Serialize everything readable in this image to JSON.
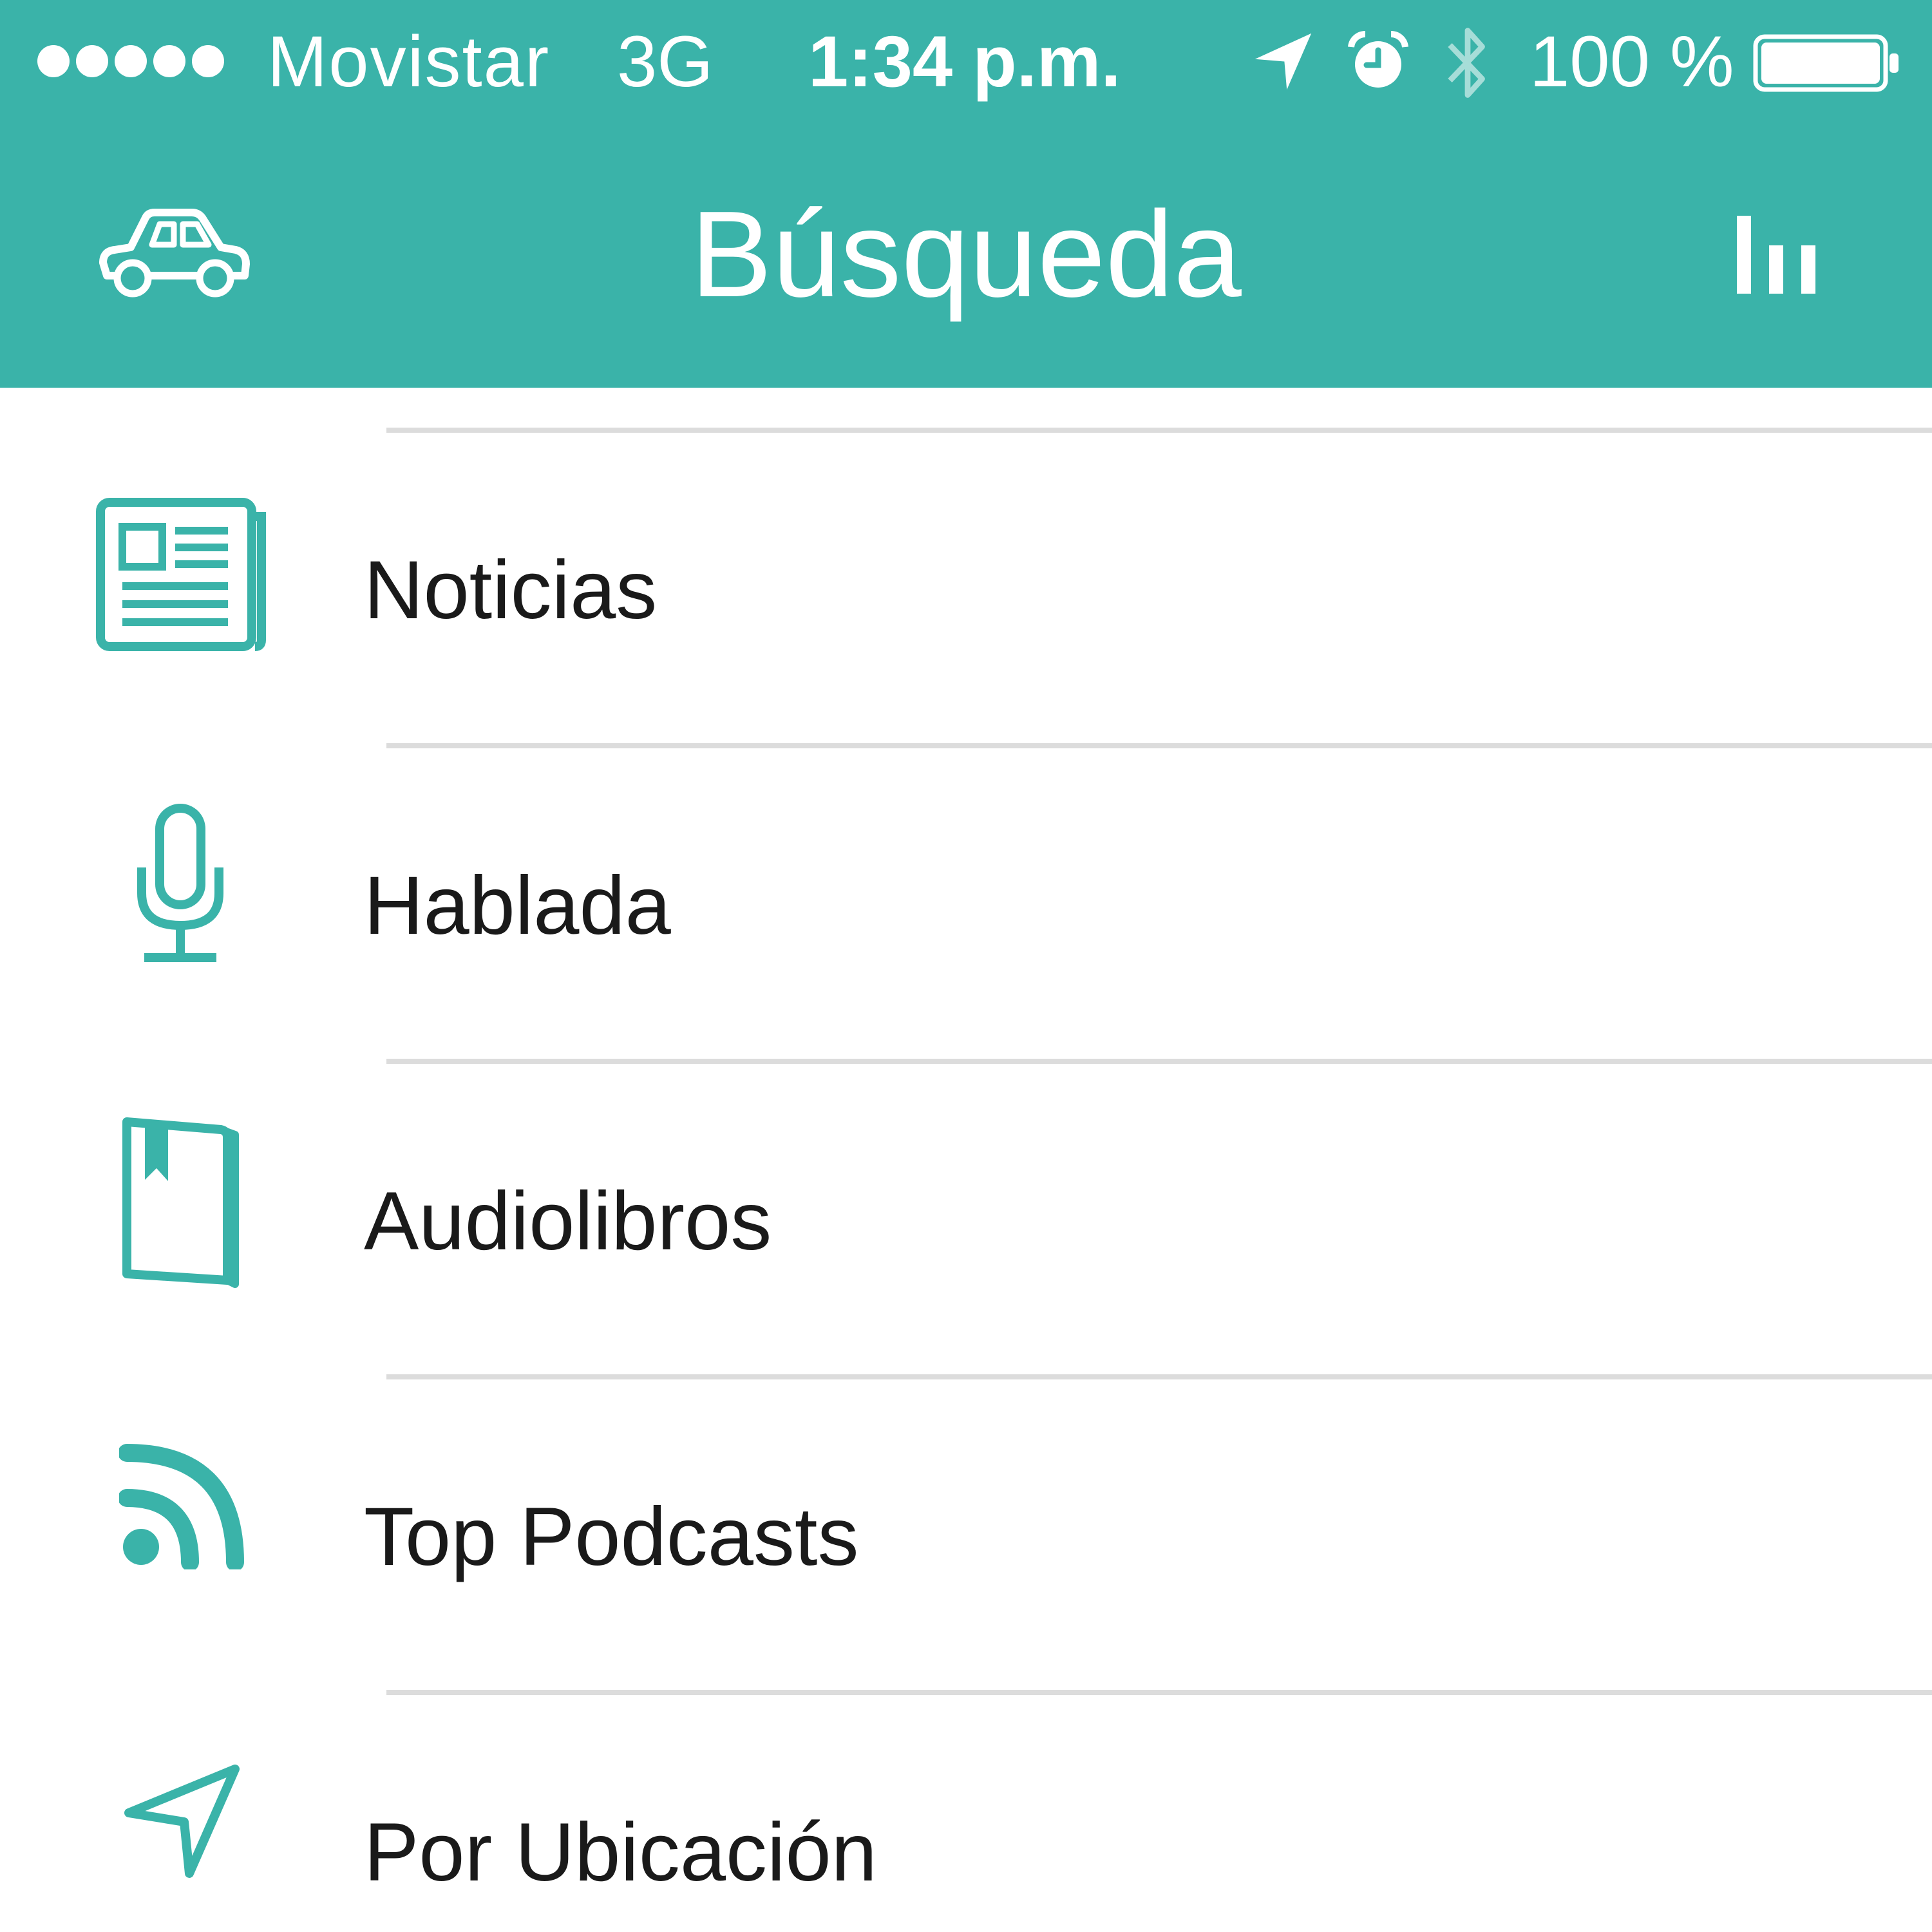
{
  "status_bar": {
    "carrier": "Movistar",
    "network": "3G",
    "time": "1:34 p.m.",
    "battery_percent": "100 %"
  },
  "nav": {
    "title": "Búsqueda"
  },
  "menu": {
    "items": [
      {
        "label": "Noticias",
        "icon": "newspaper-icon"
      },
      {
        "label": "Hablada",
        "icon": "microphone-icon"
      },
      {
        "label": "Audiolibros",
        "icon": "book-icon"
      },
      {
        "label": "Top Podcasts",
        "icon": "rss-icon"
      },
      {
        "label": "Por Ubicación",
        "icon": "location-arrow-icon"
      }
    ]
  },
  "colors": {
    "header": "#3ab3a9",
    "accent_icon": "#3ab3a9",
    "text": "#1a1a1a",
    "separator": "#dcdcdc"
  }
}
